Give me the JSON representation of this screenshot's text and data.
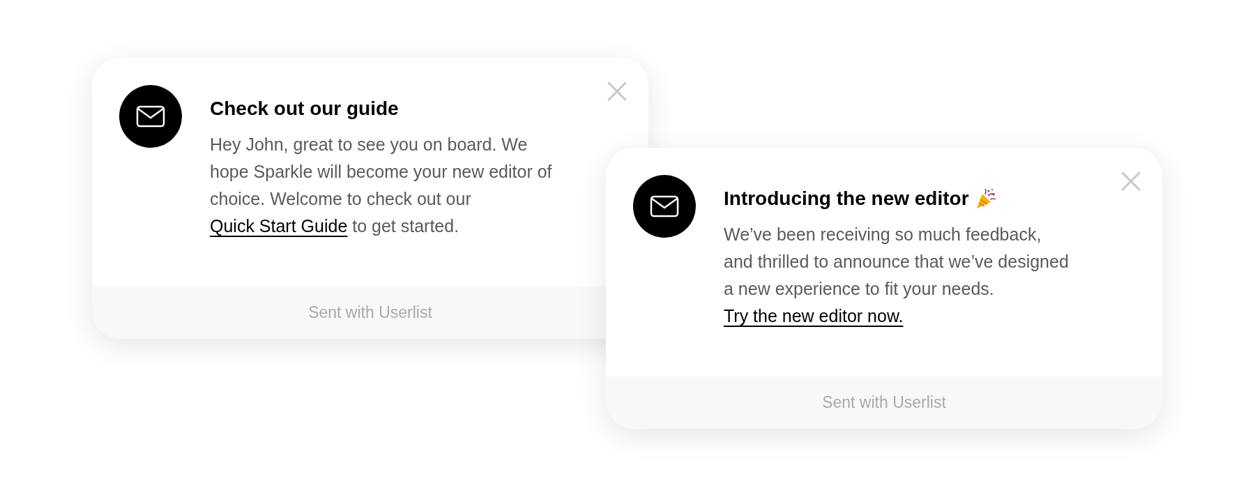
{
  "cards": [
    {
      "title": "Check out our guide",
      "party_popper": false,
      "body_before": "Hey John, great to see you on board. We hope Sparkle will become your new editor of choice. Welcome to check out our ",
      "link": "Quick Start Guide",
      "body_after": " to get started.",
      "footer": "Sent with Userlist"
    },
    {
      "title": "Introducing the new editor",
      "party_popper": true,
      "body_before": "We’ve been receiving so much feedback, and thrilled to announce that we’ve designed a new experience to fit your needs. ",
      "link": "Try the new editor now.",
      "footer": "Sent with Userlist"
    }
  ]
}
